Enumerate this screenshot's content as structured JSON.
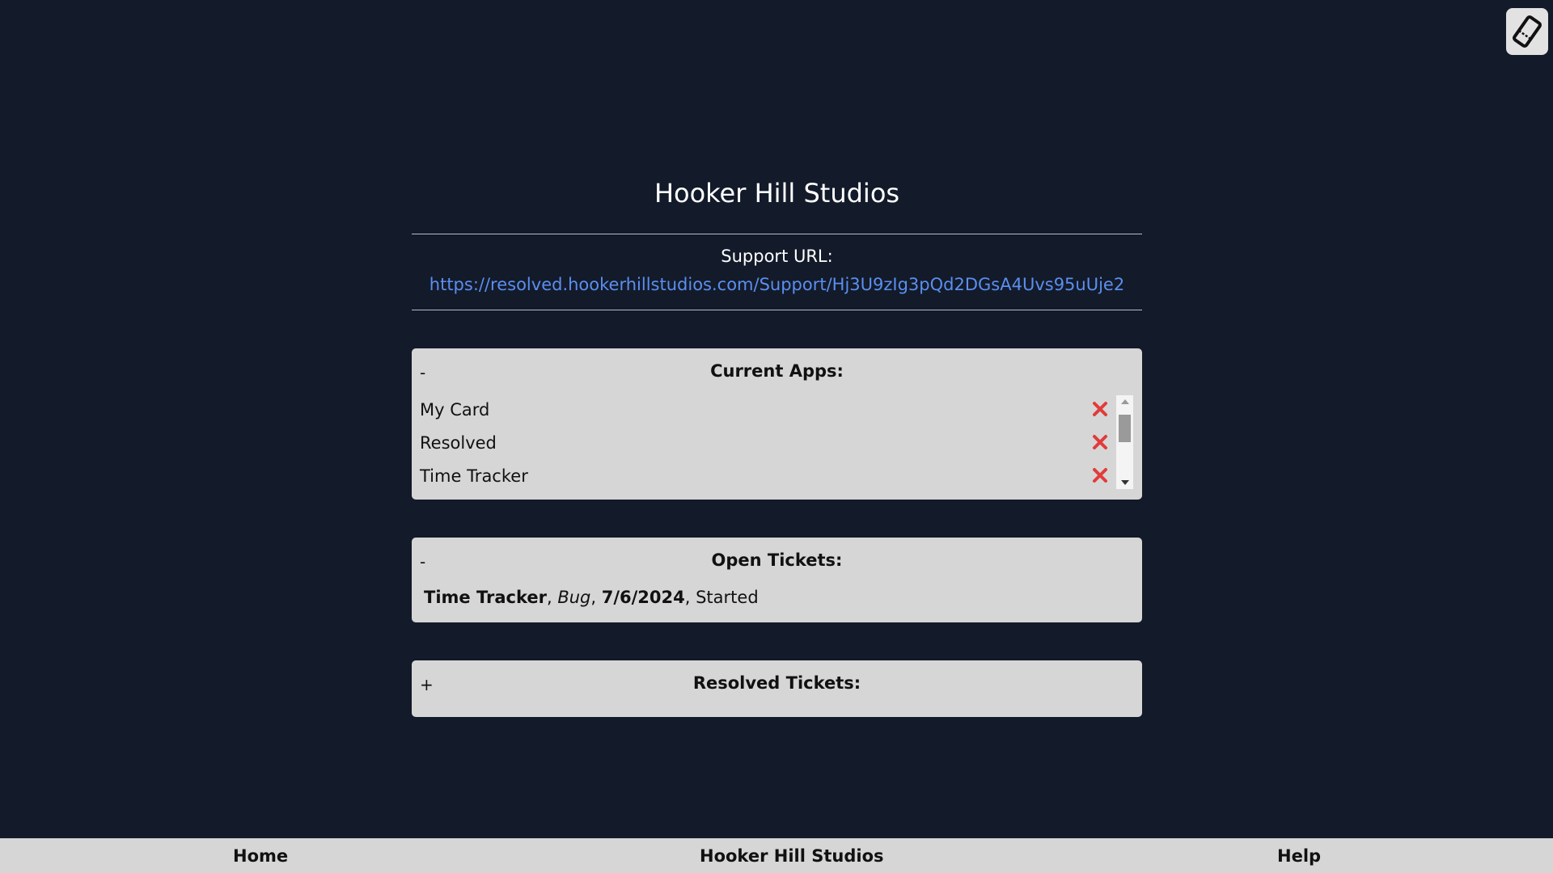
{
  "header": {
    "title": "Hooker Hill Studios",
    "corner_icon": "ticket-icon"
  },
  "support": {
    "label": "Support URL:",
    "url": "https://resolved.hookerhillstudios.com/Support/Hj3U9zIg3pQd2DGsA4Uvs95uUje2"
  },
  "current_apps": {
    "toggle": "-",
    "title": "Current Apps:",
    "remove_icon": "red-x-icon",
    "items": [
      {
        "name": "My Card"
      },
      {
        "name": "Resolved"
      },
      {
        "name": "Time Tracker"
      }
    ]
  },
  "open_tickets": {
    "toggle": "-",
    "title": "Open Tickets:",
    "items": [
      {
        "app": "Time Tracker",
        "type": "Bug",
        "date": "7/6/2024",
        "status": "Started",
        "sep": ", "
      }
    ]
  },
  "resolved_tickets": {
    "toggle": "+",
    "title": "Resolved Tickets:"
  },
  "footer": {
    "home": "Home",
    "brand": "Hooker Hill Studios",
    "help": "Help"
  },
  "colors": {
    "background": "#131a29",
    "panel": "#d6d6d6",
    "link": "#5a8ff0",
    "remove": "#e23b3b"
  }
}
